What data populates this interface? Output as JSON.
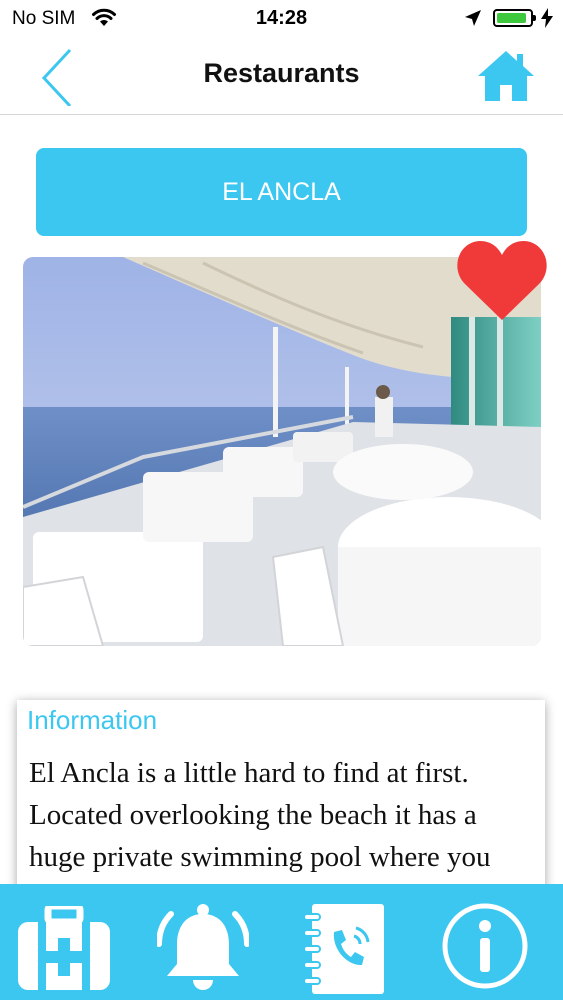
{
  "status_bar": {
    "carrier": "No SIM",
    "time": "14:28",
    "battery_level": 0.9
  },
  "nav": {
    "title": "Restaurants",
    "back_icon": "chevron-left-icon",
    "home_icon": "home-icon"
  },
  "restaurant": {
    "name": "EL ANCLA",
    "favorite": true
  },
  "info": {
    "heading": "Information",
    "text": "El Ancla is a little hard to find at first. Located overlooking the beach it has a huge private swimming pool where you can spend the entire day as well."
  },
  "tab_bar": {
    "items": [
      {
        "icon": "first-aid-kit-icon"
      },
      {
        "icon": "bell-icon"
      },
      {
        "icon": "phone-book-icon"
      },
      {
        "icon": "info-icon"
      }
    ]
  },
  "colors": {
    "accent": "#3cc7f0",
    "heart": "#f03a3a",
    "battery": "#3ec83e"
  }
}
